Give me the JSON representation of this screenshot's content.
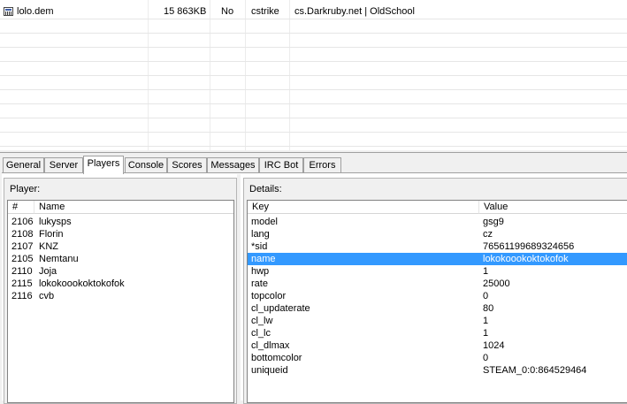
{
  "demo_list": {
    "rows": [
      {
        "file": "lolo.dem",
        "size": "15 863KB",
        "flag": "No",
        "game": "cstrike",
        "server": "cs.Darkruby.net | OldSchool"
      }
    ]
  },
  "tabs": [
    {
      "label": "General"
    },
    {
      "label": "Server"
    },
    {
      "label": "Players",
      "active": true
    },
    {
      "label": "Console"
    },
    {
      "label": "Scores"
    },
    {
      "label": "Messages"
    },
    {
      "label": "IRC Bot"
    },
    {
      "label": "Errors"
    }
  ],
  "players_panel": {
    "title": "Player:",
    "headers": {
      "num": "#",
      "name": "Name"
    },
    "players": [
      {
        "id": "2106",
        "name": "lukysps"
      },
      {
        "id": "2108",
        "name": "Florin"
      },
      {
        "id": "2107",
        "name": "KNZ"
      },
      {
        "id": "2105",
        "name": "Nemtanu"
      },
      {
        "id": "2110",
        "name": "Joja"
      },
      {
        "id": "2115",
        "name": "lokokoookoktokofok"
      },
      {
        "id": "2116",
        "name": "cvb"
      }
    ]
  },
  "details_panel": {
    "title": "Details:",
    "headers": {
      "key": "Key",
      "value": "Value"
    },
    "rows": [
      {
        "key": "model",
        "value": "gsg9"
      },
      {
        "key": "lang",
        "value": "cz"
      },
      {
        "key": "*sid",
        "value": "76561199689324656"
      },
      {
        "key": "name",
        "value": "lokokoookoktokofok",
        "selected": true
      },
      {
        "key": "hwp",
        "value": "1"
      },
      {
        "key": "rate",
        "value": "25000"
      },
      {
        "key": "topcolor",
        "value": "0"
      },
      {
        "key": "cl_updaterate",
        "value": "80"
      },
      {
        "key": "cl_lw",
        "value": "1"
      },
      {
        "key": "cl_lc",
        "value": "1"
      },
      {
        "key": "cl_dlmax",
        "value": "1024"
      },
      {
        "key": "bottomcolor",
        "value": "0"
      },
      {
        "key": "uniqueid",
        "value": "STEAM_0:0:864529464"
      }
    ]
  },
  "colors": {
    "selection": "#3399ff",
    "tab_border": "#a0a0a0"
  }
}
